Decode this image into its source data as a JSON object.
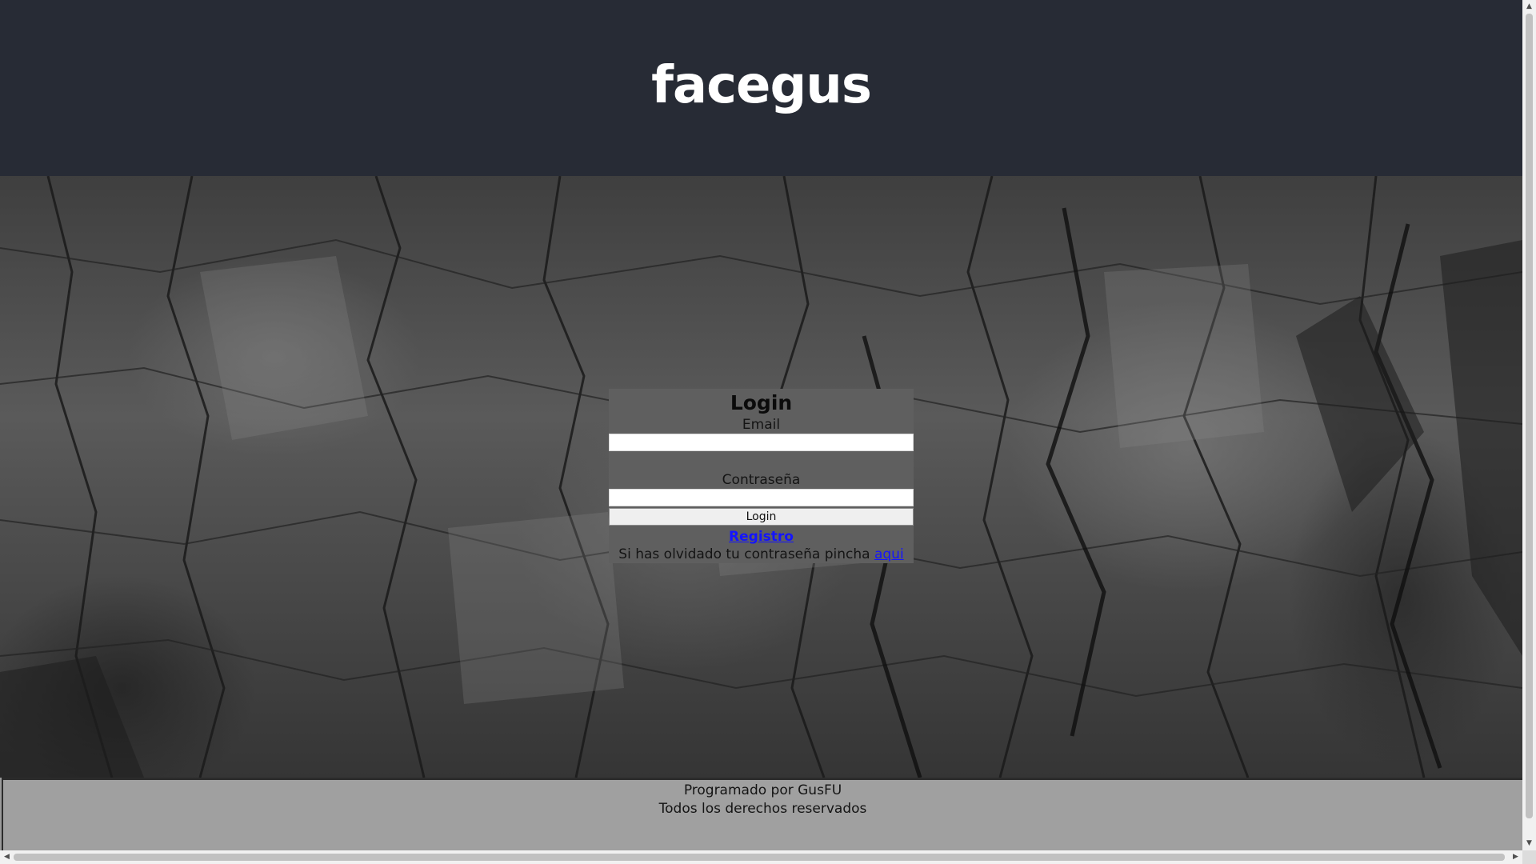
{
  "header": {
    "title": "facegus"
  },
  "login": {
    "heading": "Login",
    "email_label": "Email",
    "email_value": "",
    "password_label": "Contraseña",
    "password_value": "",
    "submit_label": "Login",
    "register_link": "Registro",
    "forgot_text": "Si has olvidado tu contraseña pincha ",
    "forgot_link": "aqui"
  },
  "footer": {
    "line1": "Programado por GusFU",
    "line2": "Todos los derechos reservados"
  },
  "scrollbars": {
    "vertical_up": "▲",
    "vertical_down": "▼",
    "horizontal_left": "◀",
    "horizontal_right": "▶"
  },
  "colors": {
    "header_bg": "#272b35",
    "login_box_bg": "#5f5f5f",
    "footer_bg": "#a0a0a0",
    "link": "#1414ff"
  }
}
